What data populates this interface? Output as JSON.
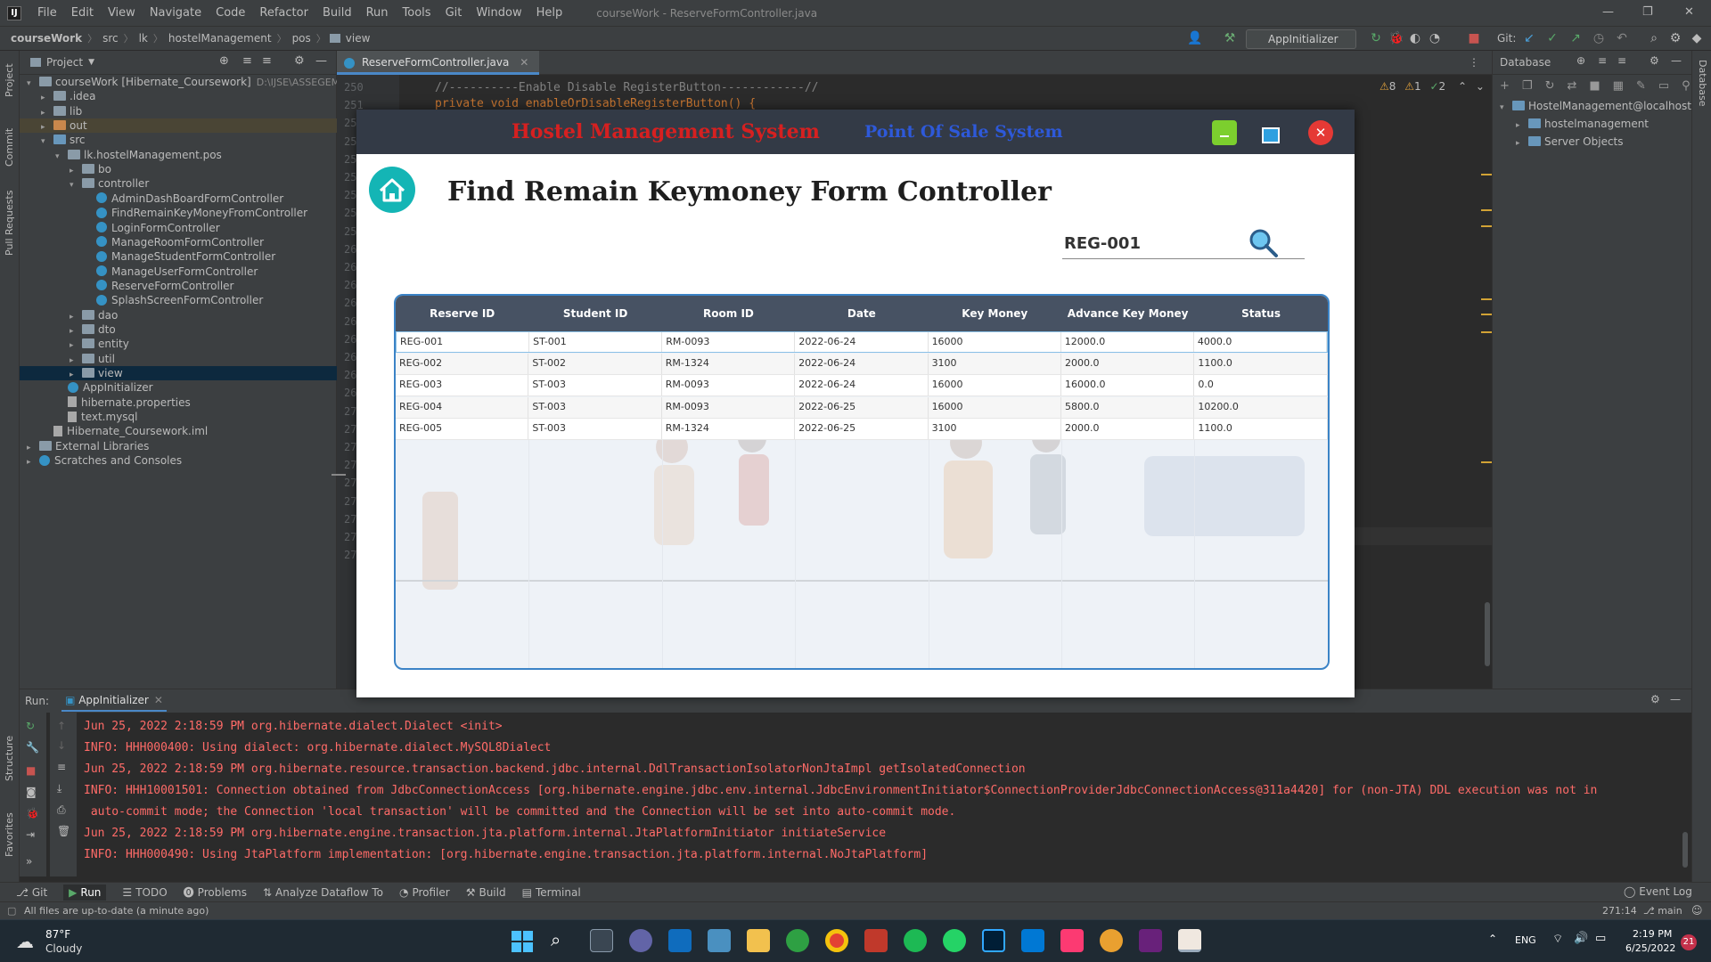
{
  "menubar": {
    "items": [
      "File",
      "Edit",
      "View",
      "Navigate",
      "Code",
      "Refactor",
      "Build",
      "Run",
      "Tools",
      "Git",
      "Window",
      "Help"
    ],
    "title": "courseWork - ReserveFormController.java"
  },
  "navbar": {
    "breadcrumbs": [
      "courseWork",
      "src",
      "lk",
      "hostelManagement",
      "pos",
      "view"
    ],
    "run_config": "AppInitializer",
    "git_label": "Git:"
  },
  "leftstrip": {
    "labels": [
      "Project",
      "Commit",
      "Pull Requests",
      "Structure",
      "Favorites"
    ]
  },
  "rightstrip": {
    "labels": [
      "Database"
    ]
  },
  "project": {
    "header": "Project",
    "tree": [
      {
        "label": "courseWork [Hibernate_Coursework]",
        "extra": "D:\\IJSE\\ASSEGEMEN",
        "indent": 0,
        "arrow": "▾",
        "icon": "folder"
      },
      {
        "label": ".idea",
        "indent": 1,
        "arrow": "▸",
        "icon": "folder"
      },
      {
        "label": "lib",
        "indent": 1,
        "arrow": "▸",
        "icon": "folder"
      },
      {
        "label": "out",
        "indent": 1,
        "arrow": "▸",
        "icon": "folder-orange"
      },
      {
        "label": "src",
        "indent": 1,
        "arrow": "▾",
        "icon": "folder-blue"
      },
      {
        "label": "lk.hostelManagement.pos",
        "indent": 2,
        "arrow": "▾",
        "icon": "folder"
      },
      {
        "label": "bo",
        "indent": 3,
        "arrow": "▸",
        "icon": "folder"
      },
      {
        "label": "controller",
        "indent": 3,
        "arrow": "▾",
        "icon": "folder"
      },
      {
        "label": "AdminDashBoardFormController",
        "indent": 4,
        "arrow": "",
        "icon": "class"
      },
      {
        "label": "FindRemainKeyMoneyFromController",
        "indent": 4,
        "arrow": "",
        "icon": "class"
      },
      {
        "label": "LoginFormController",
        "indent": 4,
        "arrow": "",
        "icon": "class"
      },
      {
        "label": "ManageRoomFormController",
        "indent": 4,
        "arrow": "",
        "icon": "class"
      },
      {
        "label": "ManageStudentFormController",
        "indent": 4,
        "arrow": "",
        "icon": "class"
      },
      {
        "label": "ManageUserFormController",
        "indent": 4,
        "arrow": "",
        "icon": "class"
      },
      {
        "label": "ReserveFormController",
        "indent": 4,
        "arrow": "",
        "icon": "class"
      },
      {
        "label": "SplashScreenFormController",
        "indent": 4,
        "arrow": "",
        "icon": "class"
      },
      {
        "label": "dao",
        "indent": 3,
        "arrow": "▸",
        "icon": "folder"
      },
      {
        "label": "dto",
        "indent": 3,
        "arrow": "▸",
        "icon": "folder"
      },
      {
        "label": "entity",
        "indent": 3,
        "arrow": "▸",
        "icon": "folder"
      },
      {
        "label": "util",
        "indent": 3,
        "arrow": "▸",
        "icon": "folder"
      },
      {
        "label": "view",
        "indent": 3,
        "arrow": "▸",
        "icon": "folder",
        "selected": true
      },
      {
        "label": "AppInitializer",
        "indent": 2,
        "arrow": "",
        "icon": "class"
      },
      {
        "label": "hibernate.properties",
        "indent": 2,
        "arrow": "",
        "icon": "file"
      },
      {
        "label": "text.mysql",
        "indent": 2,
        "arrow": "",
        "icon": "file"
      },
      {
        "label": "Hibernate_Coursework.iml",
        "indent": 1,
        "arrow": "",
        "icon": "file"
      },
      {
        "label": "External Libraries",
        "indent": 0,
        "arrow": "▸",
        "icon": "lib"
      },
      {
        "label": "Scratches and Consoles",
        "indent": 0,
        "arrow": "▸",
        "icon": "scratch"
      }
    ]
  },
  "editor": {
    "tab": "ReserveFormController.java",
    "line_numbers": [
      "250",
      "251",
      "25",
      "25",
      "25",
      "25",
      "25",
      "25",
      "25",
      "26",
      "26",
      "26",
      "26",
      "26",
      "26",
      "26",
      "26",
      "26",
      "27",
      "27",
      "27",
      "27",
      "27",
      "27",
      "27",
      "27",
      "27"
    ],
    "line1": "//----------Enable Disable RegisterButton------------//",
    "line2": "private void enableOrDisableRegisterButton() {",
    "inspections": {
      "warnings": "8",
      "weak": "1",
      "ok": "2"
    }
  },
  "database": {
    "header": "Database",
    "tree": [
      {
        "label": "HostelManagement@localhost",
        "indent": 0,
        "arrow": "▾"
      },
      {
        "label": "hostelmanagement",
        "indent": 1,
        "arrow": "▸"
      },
      {
        "label": "Server Objects",
        "indent": 1,
        "arrow": "▸"
      }
    ]
  },
  "app": {
    "title": "Hostel Management System",
    "subtitle": "Point Of Sale System",
    "form_title": "Find Remain Keymoney Form Controller",
    "search_value": "REG-001",
    "columns": [
      "Reserve ID",
      "Student ID",
      "Room ID",
      "Date",
      "Key Money",
      "Advance Key Money",
      "Status"
    ],
    "rows": [
      [
        "REG-001",
        "ST-001",
        "RM-0093",
        "2022-06-24",
        "16000",
        "12000.0",
        "4000.0"
      ],
      [
        "REG-002",
        "ST-002",
        "RM-1324",
        "2022-06-24",
        "3100",
        "2000.0",
        "1100.0"
      ],
      [
        "REG-003",
        "ST-003",
        "RM-0093",
        "2022-06-24",
        "16000",
        "16000.0",
        "0.0"
      ],
      [
        "REG-004",
        "ST-003",
        "RM-0093",
        "2022-06-25",
        "16000",
        "5800.0",
        "10200.0"
      ],
      [
        "REG-005",
        "ST-003",
        "RM-1324",
        "2022-06-25",
        "3100",
        "2000.0",
        "1100.0"
      ]
    ]
  },
  "run": {
    "label": "Run:",
    "tab": "AppInitializer",
    "log": [
      "Jun 25, 2022 2:18:59 PM org.hibernate.dialect.Dialect <init>",
      "INFO: HHH000400: Using dialect: org.hibernate.dialect.MySQL8Dialect",
      "Jun 25, 2022 2:18:59 PM org.hibernate.resource.transaction.backend.jdbc.internal.DdlTransactionIsolatorNonJtaImpl getIsolatedConnection",
      "INFO: HHH10001501: Connection obtained from JdbcConnectionAccess [org.hibernate.engine.jdbc.env.internal.JdbcEnvironmentInitiator$ConnectionProviderJdbcConnectionAccess@311a4420] for (non-JTA) DDL execution was not in",
      " auto-commit mode; the Connection 'local transaction' will be committed and the Connection will be set into auto-commit mode.",
      "Jun 25, 2022 2:18:59 PM org.hibernate.engine.transaction.jta.platform.internal.JtaPlatformInitiator initiateService",
      "INFO: HHH000490: Using JtaPlatform implementation: [org.hibernate.engine.transaction.jta.platform.internal.NoJtaPlatform]"
    ]
  },
  "bottom_tools": [
    "Git",
    "Run",
    "TODO",
    "Problems",
    "Analyze Dataflow To",
    "Profiler",
    "Build",
    "Terminal"
  ],
  "event_log": "Event Log",
  "status": {
    "message": "All files are up-to-date (a minute ago)",
    "position": "271:14",
    "branch": "main"
  },
  "taskbar": {
    "weather_temp": "87°F",
    "weather_desc": "Cloudy",
    "lang": "ENG",
    "time": "2:19 PM",
    "date": "6/25/2022",
    "notifications": "21"
  },
  "colors": {
    "app_title": "#d62020",
    "app_subtitle": "#2e59d9",
    "table_border": "#3b83c6",
    "table_header": "#475263",
    "log_text": "#ff6b68"
  }
}
